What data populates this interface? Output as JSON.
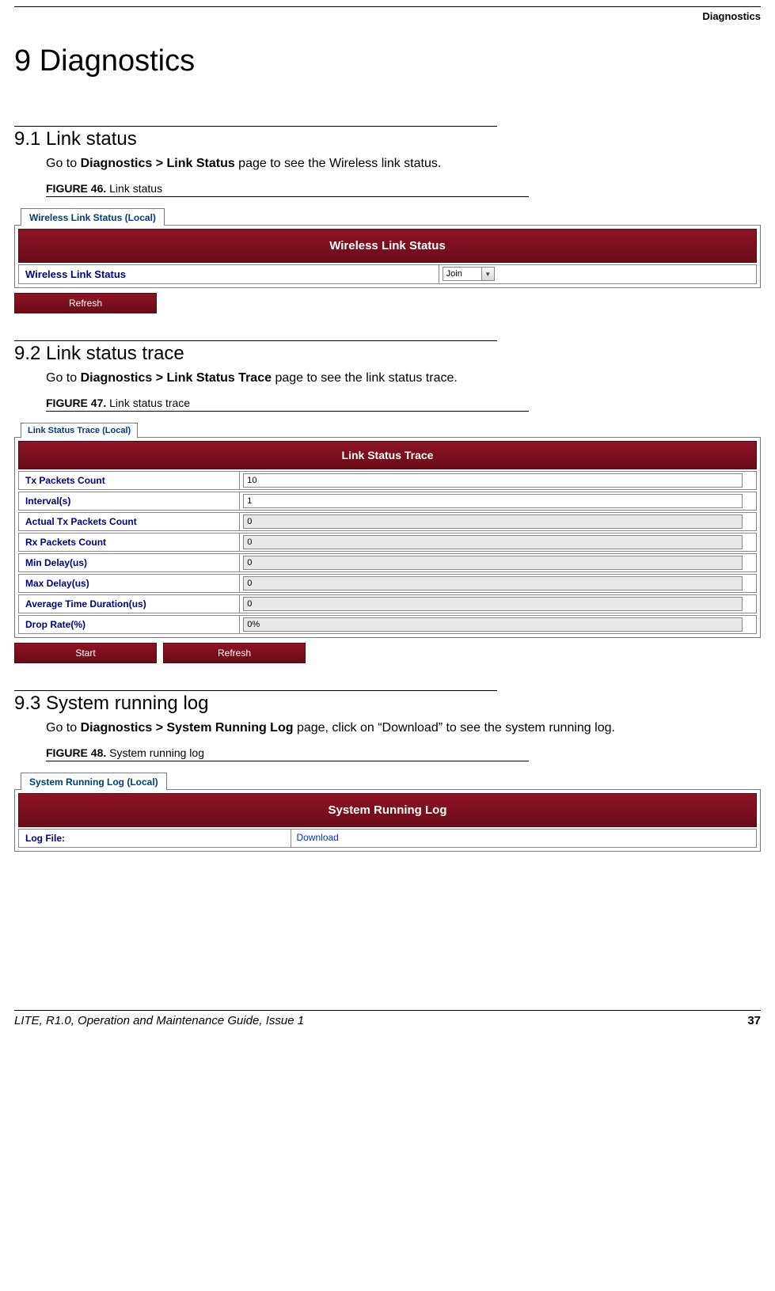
{
  "header": {
    "topic": "Diagnostics"
  },
  "chapter": {
    "title": "9 Diagnostics"
  },
  "s91": {
    "heading": "9.1 Link status",
    "body_pre": "Go to ",
    "body_bold": "Diagnostics > Link Status",
    "body_post": " page to see the Wireless link status.",
    "fig_label": "FIGURE 46.",
    "fig_title": " Link status",
    "tab": "Wireless Link Status (Local)",
    "panel_title": "Wireless Link Status",
    "row_label": "Wireless Link Status",
    "row_value": "Join",
    "btn_refresh": "Refresh"
  },
  "s92": {
    "heading": "9.2 Link status trace",
    "body_pre": "Go to ",
    "body_bold": "Diagnostics > Link Status Trace",
    "body_post": " page to see the link status trace.",
    "fig_label": "FIGURE 47.",
    "fig_title": " Link status trace",
    "tab": "Link Status Trace (Local)",
    "panel_title": "Link Status Trace",
    "rows": [
      {
        "label": "Tx Packets Count",
        "value": "10",
        "readonly": false
      },
      {
        "label": "Interval(s)",
        "value": "1",
        "readonly": false
      },
      {
        "label": "Actual Tx Packets Count",
        "value": "0",
        "readonly": true
      },
      {
        "label": "Rx Packets Count",
        "value": "0",
        "readonly": true
      },
      {
        "label": "Min Delay(us)",
        "value": "0",
        "readonly": true
      },
      {
        "label": "Max Delay(us)",
        "value": "0",
        "readonly": true
      },
      {
        "label": "Average Time Duration(us)",
        "value": "0",
        "readonly": true
      },
      {
        "label": "Drop Rate(%)",
        "value": "0%",
        "readonly": true
      }
    ],
    "btn_start": "Start",
    "btn_refresh": "Refresh"
  },
  "s93": {
    "heading": "9.3 System running log",
    "body_pre": "Go to ",
    "body_bold": "Diagnostics > System Running Log",
    "body_post": " page, click on “Download” to see the system running log.",
    "fig_label": "FIGURE 48.",
    "fig_title": " System running log",
    "tab": "System Running Log (Local)",
    "panel_title": "System Running Log",
    "row_label": "Log File:",
    "row_link": "Download"
  },
  "footer": {
    "left": "LITE, R1.0, Operation and Maintenance Guide, Issue 1",
    "page": "37"
  }
}
